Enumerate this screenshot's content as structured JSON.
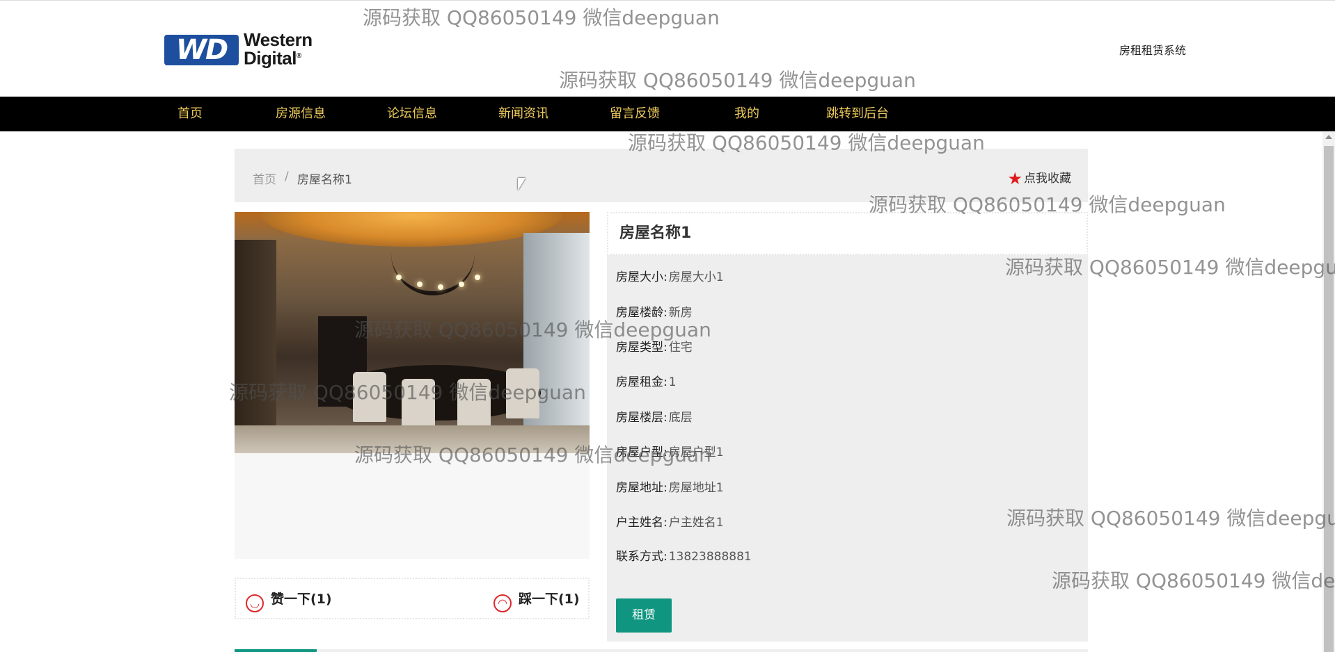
{
  "header": {
    "logo_badge": "WD",
    "logo_line1": "Western",
    "logo_line2": "Digital",
    "logo_reg": "®",
    "site_title": "房租租赁系统"
  },
  "nav": {
    "items": [
      {
        "label": "首页"
      },
      {
        "label": "房源信息"
      },
      {
        "label": "论坛信息"
      },
      {
        "label": "新闻资讯"
      },
      {
        "label": "留言反馈"
      },
      {
        "label": "我的"
      },
      {
        "label": "跳转到后台"
      }
    ],
    "text_color": "#f0cd5a"
  },
  "breadcrumb": {
    "home": "首页",
    "separator": "/",
    "current": "房屋名称1"
  },
  "favorite": {
    "icon": "star-icon",
    "label": "点我收藏"
  },
  "house": {
    "title": "房屋名称1",
    "fields": [
      {
        "key": "房屋大小:",
        "value": "房屋大小1"
      },
      {
        "key": "房屋楼龄:",
        "value": "新房"
      },
      {
        "key": "房屋类型:",
        "value": "住宅"
      },
      {
        "key": "房屋租金:",
        "value": "1"
      },
      {
        "key": "房屋楼层:",
        "value": "底层"
      },
      {
        "key": "房屋户型:",
        "value": "房屋户型1"
      },
      {
        "key": "房屋地址:",
        "value": "房屋地址1"
      },
      {
        "key": "户主姓名:",
        "value": "户主姓名1"
      },
      {
        "key": "联系方式:",
        "value": "13823888881"
      }
    ],
    "rent_button": "租赁"
  },
  "votes": {
    "up_label": "赞一下(1)",
    "down_label": "踩一下(1)"
  },
  "watermark_text": "源码获取 QQ86050149 微信deepguan",
  "colors": {
    "accent": "#109680",
    "nav_bg": "#000000",
    "vote_icon": "#e0282a",
    "star": "#e01a1a"
  }
}
